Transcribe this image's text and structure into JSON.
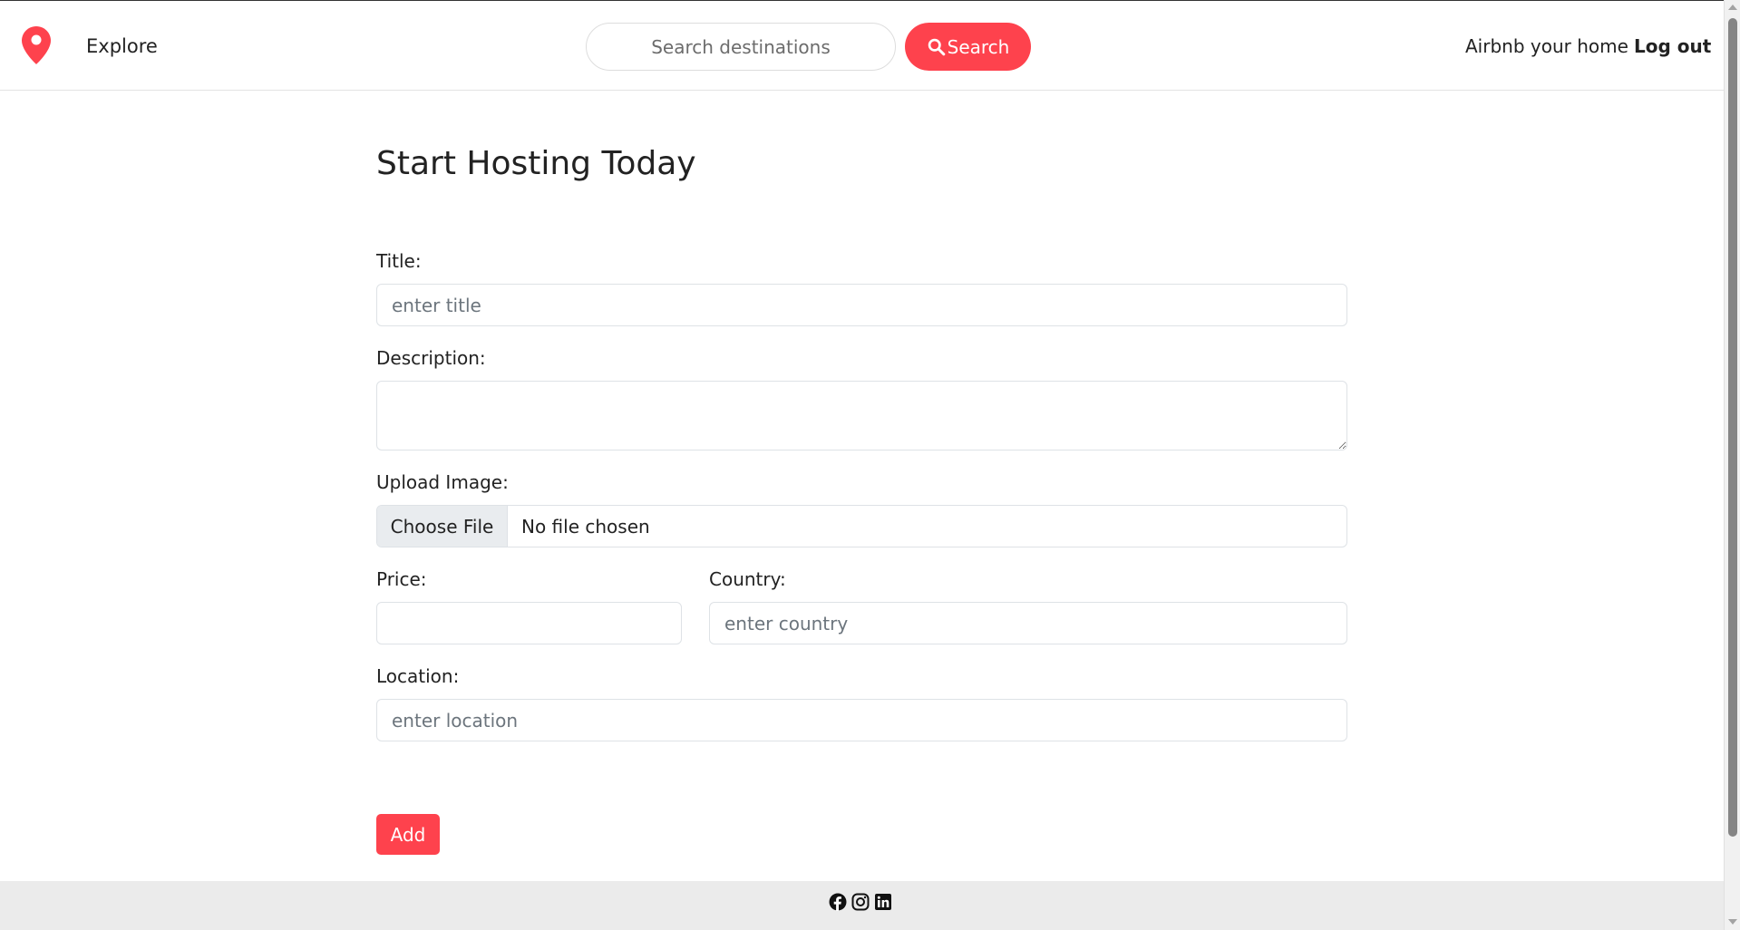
{
  "navbar": {
    "brand_icon": "location-pin-icon",
    "explore_label": "Explore",
    "search_placeholder": "Search destinations",
    "search_button_label": "Search",
    "search_icon": "magnifier-icon",
    "host_link_label": "Airbnb your home",
    "logout_label": "Log out"
  },
  "form": {
    "heading": "Start Hosting Today",
    "title_label": "Title:",
    "title_placeholder": "enter title",
    "description_label": "Description:",
    "image_label": "Upload Image:",
    "choose_file_label": "Choose File",
    "file_status": "No file chosen",
    "price_label": "Price:",
    "country_label": "Country:",
    "country_placeholder": "enter country",
    "location_label": "Location:",
    "location_placeholder": "enter location",
    "add_button_label": "Add"
  },
  "footer": {
    "social_icons": [
      "facebook-icon",
      "instagram-icon",
      "linkedin-icon"
    ]
  },
  "colors": {
    "accent": "#fe424d",
    "text": "#222222",
    "footer_bg": "#ebebeb"
  }
}
